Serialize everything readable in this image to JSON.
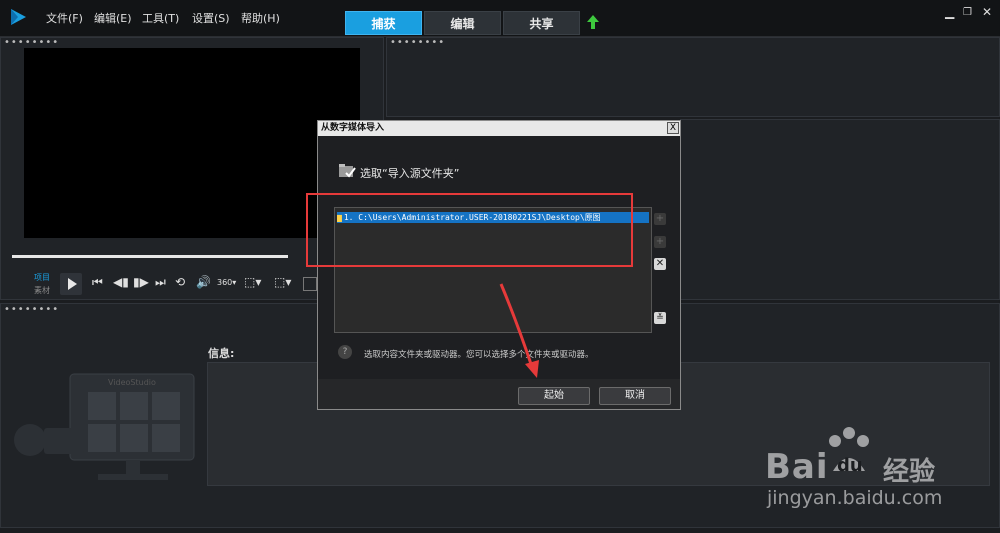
{
  "menu": {
    "file": "文件(F)",
    "edit": "编辑(E)",
    "tools": "工具(T)",
    "settings": "设置(S)",
    "help": "帮助(H)"
  },
  "tabs": {
    "capture": "捕获",
    "edit": "编辑",
    "share": "共享"
  },
  "player": {
    "project_label": "项目",
    "clip_label": "素材"
  },
  "info": {
    "label": "信息:"
  },
  "watermark": {
    "videostudio": "VideoStudio",
    "brand": "Bai",
    "brand_suffix": "du",
    "jingyan": "经验",
    "url": "jingyan.baidu.com"
  },
  "dialog": {
    "title": "从数字媒体导入",
    "close": "X",
    "heading": "选取“导入源文件夹”",
    "path_item": "1. C:\\Users\\Administrator.USER-20180221SJ\\Desktop\\原图",
    "hint": "选取内容文件夹或驱动器。您可以选择多个文件夹或驱动器。",
    "start_button": "起始",
    "cancel_button": "取消"
  },
  "colors": {
    "accent": "#1a9fe0",
    "highlight": "#e63a3a",
    "selection": "#1573c4"
  }
}
